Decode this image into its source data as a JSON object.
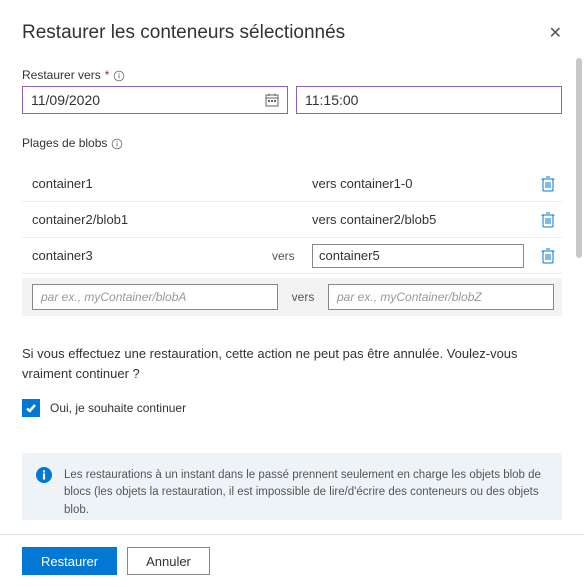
{
  "dialog": {
    "title": "Restaurer les conteneurs sélectionnés"
  },
  "restoreTo": {
    "label": "Restaurer vers",
    "date": "11/09/2020",
    "time": "11:15:00"
  },
  "ranges": {
    "label": "Plages de blobs",
    "versWord": "vers",
    "rows": [
      {
        "from": "container1",
        "toPrefix": "vers ",
        "to": "container1-0"
      },
      {
        "from": "container2/blob1",
        "toPrefix": "vers ",
        "to": "container2/blob5"
      },
      {
        "from": "container3",
        "toPrefix": "vers",
        "to": "container5",
        "editableTo": true
      }
    ],
    "newRow": {
      "fromPlaceholder": "par ex., myContainer/blobA",
      "toPlaceholder": "par ex., myContainer/blobZ"
    }
  },
  "confirm": {
    "warning": "Si vous effectuez une restauration, cette action ne peut pas être annulée. Voulez-vous vraiment continuer ?",
    "checkboxLabel": "Oui, je souhaite continuer"
  },
  "infoBox": {
    "text": "Les restaurations à un instant dans le passé prennent seulement en charge les objets blob de blocs (les objets la restauration, il est impossible de lire/d'écrire des conteneurs ou des objets blob."
  },
  "footer": {
    "primary": "Restaurer",
    "secondary": "Annuler"
  }
}
